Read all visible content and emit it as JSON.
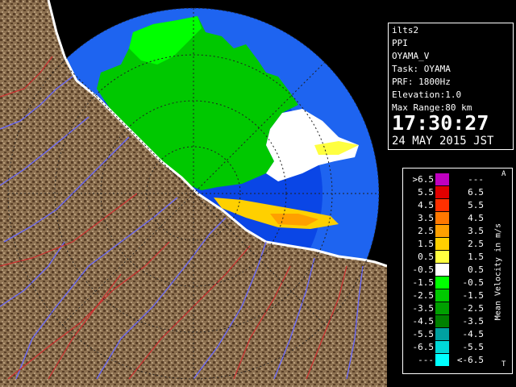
{
  "info": {
    "radar_id": "ilts2",
    "product": "PPI",
    "site": "OYAMA_V",
    "task": "Task: OYAMA",
    "prf": "PRF: 1800Hz",
    "elevation": "Elevation:1.0",
    "max_range": "Max Range:80 km",
    "time": "17:30:27",
    "date": "24 MAY 2015 JST"
  },
  "legend": {
    "title": "Mean Velocity in m/s",
    "corner_top": "A",
    "corner_bottom": "T",
    "rows": [
      {
        "lo": ">6.5",
        "hi": "---",
        "color": "#c000c0"
      },
      {
        "lo": "5.5",
        "hi": "6.5",
        "color": "#e00000"
      },
      {
        "lo": "4.5",
        "hi": "5.5",
        "color": "#ff3000"
      },
      {
        "lo": "3.5",
        "hi": "4.5",
        "color": "#ff7800"
      },
      {
        "lo": "2.5",
        "hi": "3.5",
        "color": "#ffa000"
      },
      {
        "lo": "1.5",
        "hi": "2.5",
        "color": "#ffd000"
      },
      {
        "lo": "0.5",
        "hi": "1.5",
        "color": "#ffff40"
      },
      {
        "lo": "-0.5",
        "hi": "0.5",
        "color": "#ffffff"
      },
      {
        "lo": "-1.5",
        "hi": "-0.5",
        "color": "#00ff00"
      },
      {
        "lo": "-2.5",
        "hi": "-1.5",
        "color": "#00c800"
      },
      {
        "lo": "-3.5",
        "hi": "-2.5",
        "color": "#00a000"
      },
      {
        "lo": "-4.5",
        "hi": "-3.5",
        "color": "#008000"
      },
      {
        "lo": "-5.5",
        "hi": "-4.5",
        "color": "#00a0a0"
      },
      {
        "lo": "-6.5",
        "hi": "-5.5",
        "color": "#00d8d8"
      },
      {
        "lo": "---",
        "hi": "<-6.5",
        "color": "#00ffff"
      }
    ]
  },
  "colors": {
    "background": "#000000",
    "range_disk": "#1e64f0",
    "sea_near": "#0a46e6",
    "land": "#8c7050",
    "land_dark": "#5a4028",
    "coast": "#ffffff",
    "rivers": "#6a6aff",
    "boundaries": "#d03030",
    "range_rings": "#202020"
  }
}
